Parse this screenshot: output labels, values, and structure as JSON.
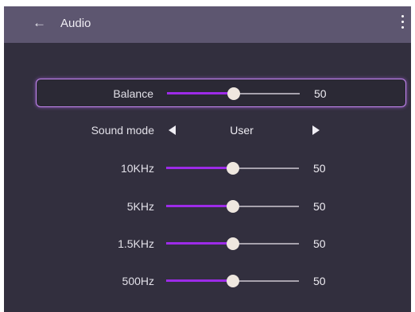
{
  "header": {
    "title": "Audio",
    "back_icon": "arrow-left-icon",
    "menu_icon": "more-vert-icon",
    "background": "#5d5670"
  },
  "colors": {
    "panel": "#322f3e",
    "accent": "#9d2be8",
    "focus_border": "#c386f0"
  },
  "settings": {
    "balance": {
      "label": "Balance",
      "value": "50",
      "level": 0.5
    },
    "sound_mode": {
      "label": "Sound mode",
      "value": "User"
    },
    "eq_10khz": {
      "label": "10KHz",
      "value": "50",
      "level": 0.5
    },
    "eq_5khz": {
      "label": "5KHz",
      "value": "50",
      "level": 0.5
    },
    "eq_1_5khz": {
      "label": "1.5KHz",
      "value": "50",
      "level": 0.5
    },
    "eq_500hz": {
      "label": "500Hz",
      "value": "50",
      "level": 0.5
    }
  }
}
